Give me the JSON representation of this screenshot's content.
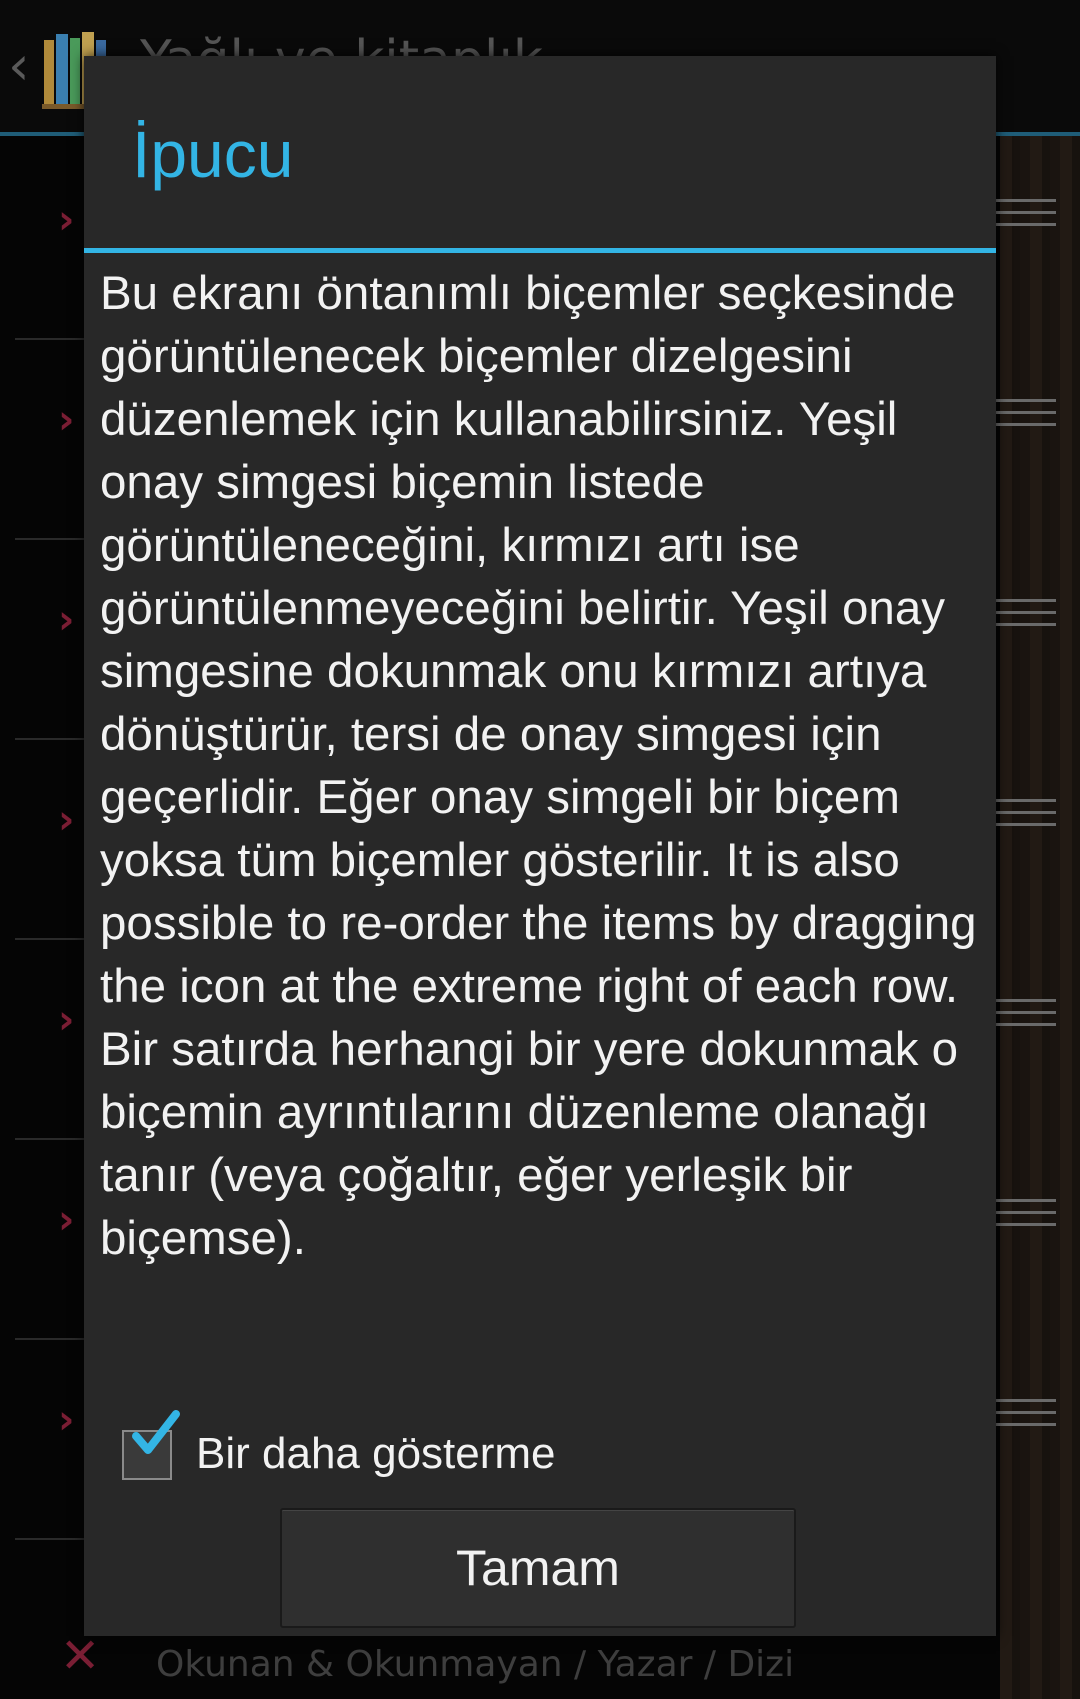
{
  "background": {
    "title": "Yağlı ve kitaplık",
    "last_row_text": "Okunan & Okunmayan / Yazar / Dizi"
  },
  "dialog": {
    "title": "İpucu",
    "body": "Bu ekranı öntanımlı biçemler seçkesinde görüntülenecek biçemler dizelgesini düzenlemek için kullanabilirsiniz. Yeşil onay simgesi biçemin listede görüntüleneceğini, kırmızı artı ise görüntülenmeyeceğini belirtir. Yeşil onay simgesine dokunmak onu kırmızı artıya dönüştürür, tersi de onay simgesi için geçerlidir. Eğer onay simgeli bir biçem yoksa tüm biçemler gösterilir. It is also possible to re-order the items by dragging the icon at the extreme right of each row. Bir satırda herhangi bir yere dokunmak o biçemin ayrıntılarını düzenleme olanağı tanır (veya çoğaltır, eğer yerleşik bir biçemse).",
    "checkbox_label": "Bir daha gösterme",
    "checkbox_checked": true,
    "ok_label": "Tamam"
  },
  "colors": {
    "accent": "#33b5e5",
    "dialog_bg": "#282828",
    "row_mark": "#7a1e34"
  },
  "icons": {
    "back": "chevron-left-icon",
    "app": "bookshelf-app-icon",
    "row_mark": "red-cross-icon",
    "drag": "drag-handle-icon",
    "check": "checkmark-icon"
  }
}
